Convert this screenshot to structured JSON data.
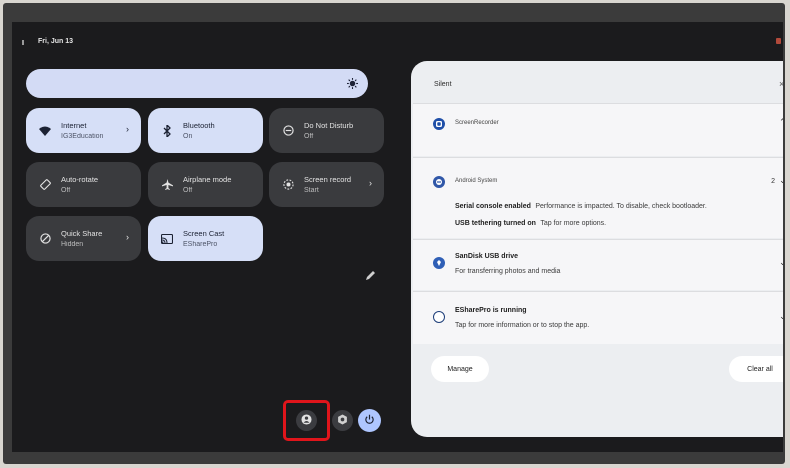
{
  "status_bar": {
    "date": "Fri, Jun 13"
  },
  "quick_settings": {
    "tiles": [
      {
        "name": "internet",
        "title": "Internet",
        "subtitle": "IG3Education",
        "state": "on",
        "icon": "wifi-icon",
        "has_chevron": true
      },
      {
        "name": "bluetooth",
        "title": "Bluetooth",
        "subtitle": "On",
        "state": "on",
        "icon": "bluetooth-icon",
        "has_chevron": false
      },
      {
        "name": "do-not-disturb",
        "title": "Do Not Disturb",
        "subtitle": "Off",
        "state": "off",
        "icon": "do-not-disturb-icon",
        "has_chevron": false
      },
      {
        "name": "auto-rotate",
        "title": "Auto-rotate",
        "subtitle": "Off",
        "state": "off",
        "icon": "rotate-icon",
        "has_chevron": false
      },
      {
        "name": "airplane-mode",
        "title": "Airplane mode",
        "subtitle": "Off",
        "state": "off",
        "icon": "airplane-icon",
        "has_chevron": false
      },
      {
        "name": "screen-record",
        "title": "Screen record",
        "subtitle": "Start",
        "state": "off",
        "icon": "screen-record-icon",
        "has_chevron": true
      },
      {
        "name": "quick-share",
        "title": "Quick Share",
        "subtitle": "Hidden",
        "state": "off",
        "icon": "quick-share-icon",
        "has_chevron": true
      },
      {
        "name": "screen-cast",
        "title": "Screen Cast",
        "subtitle": "ESharePro",
        "state": "on",
        "icon": "cast-icon",
        "has_chevron": false
      }
    ]
  },
  "notifications": {
    "section_title": "Silent",
    "close_glyph": "×",
    "items": [
      {
        "app": "ScreenRecorder"
      },
      {
        "app": "Android System",
        "count": "2",
        "line1_bold": "Serial console enabled",
        "line1_text": "Performance is impacted. To disable, check bootloader.",
        "line2_bold": "USB tethering turned on",
        "line2_text": "Tap for more options."
      },
      {
        "title": "SanDisk USB drive",
        "text": "For transferring photos and media"
      },
      {
        "title": "ESharePro is running",
        "text": "Tap for more information or to stop the app."
      }
    ],
    "manage_label": "Manage",
    "clear_all_label": "Clear all"
  },
  "colors": {
    "tile_on": "#d6dff7",
    "tile_off": "#3a3b3e",
    "accent": "#aec6ff",
    "highlight": "#e0151b"
  }
}
